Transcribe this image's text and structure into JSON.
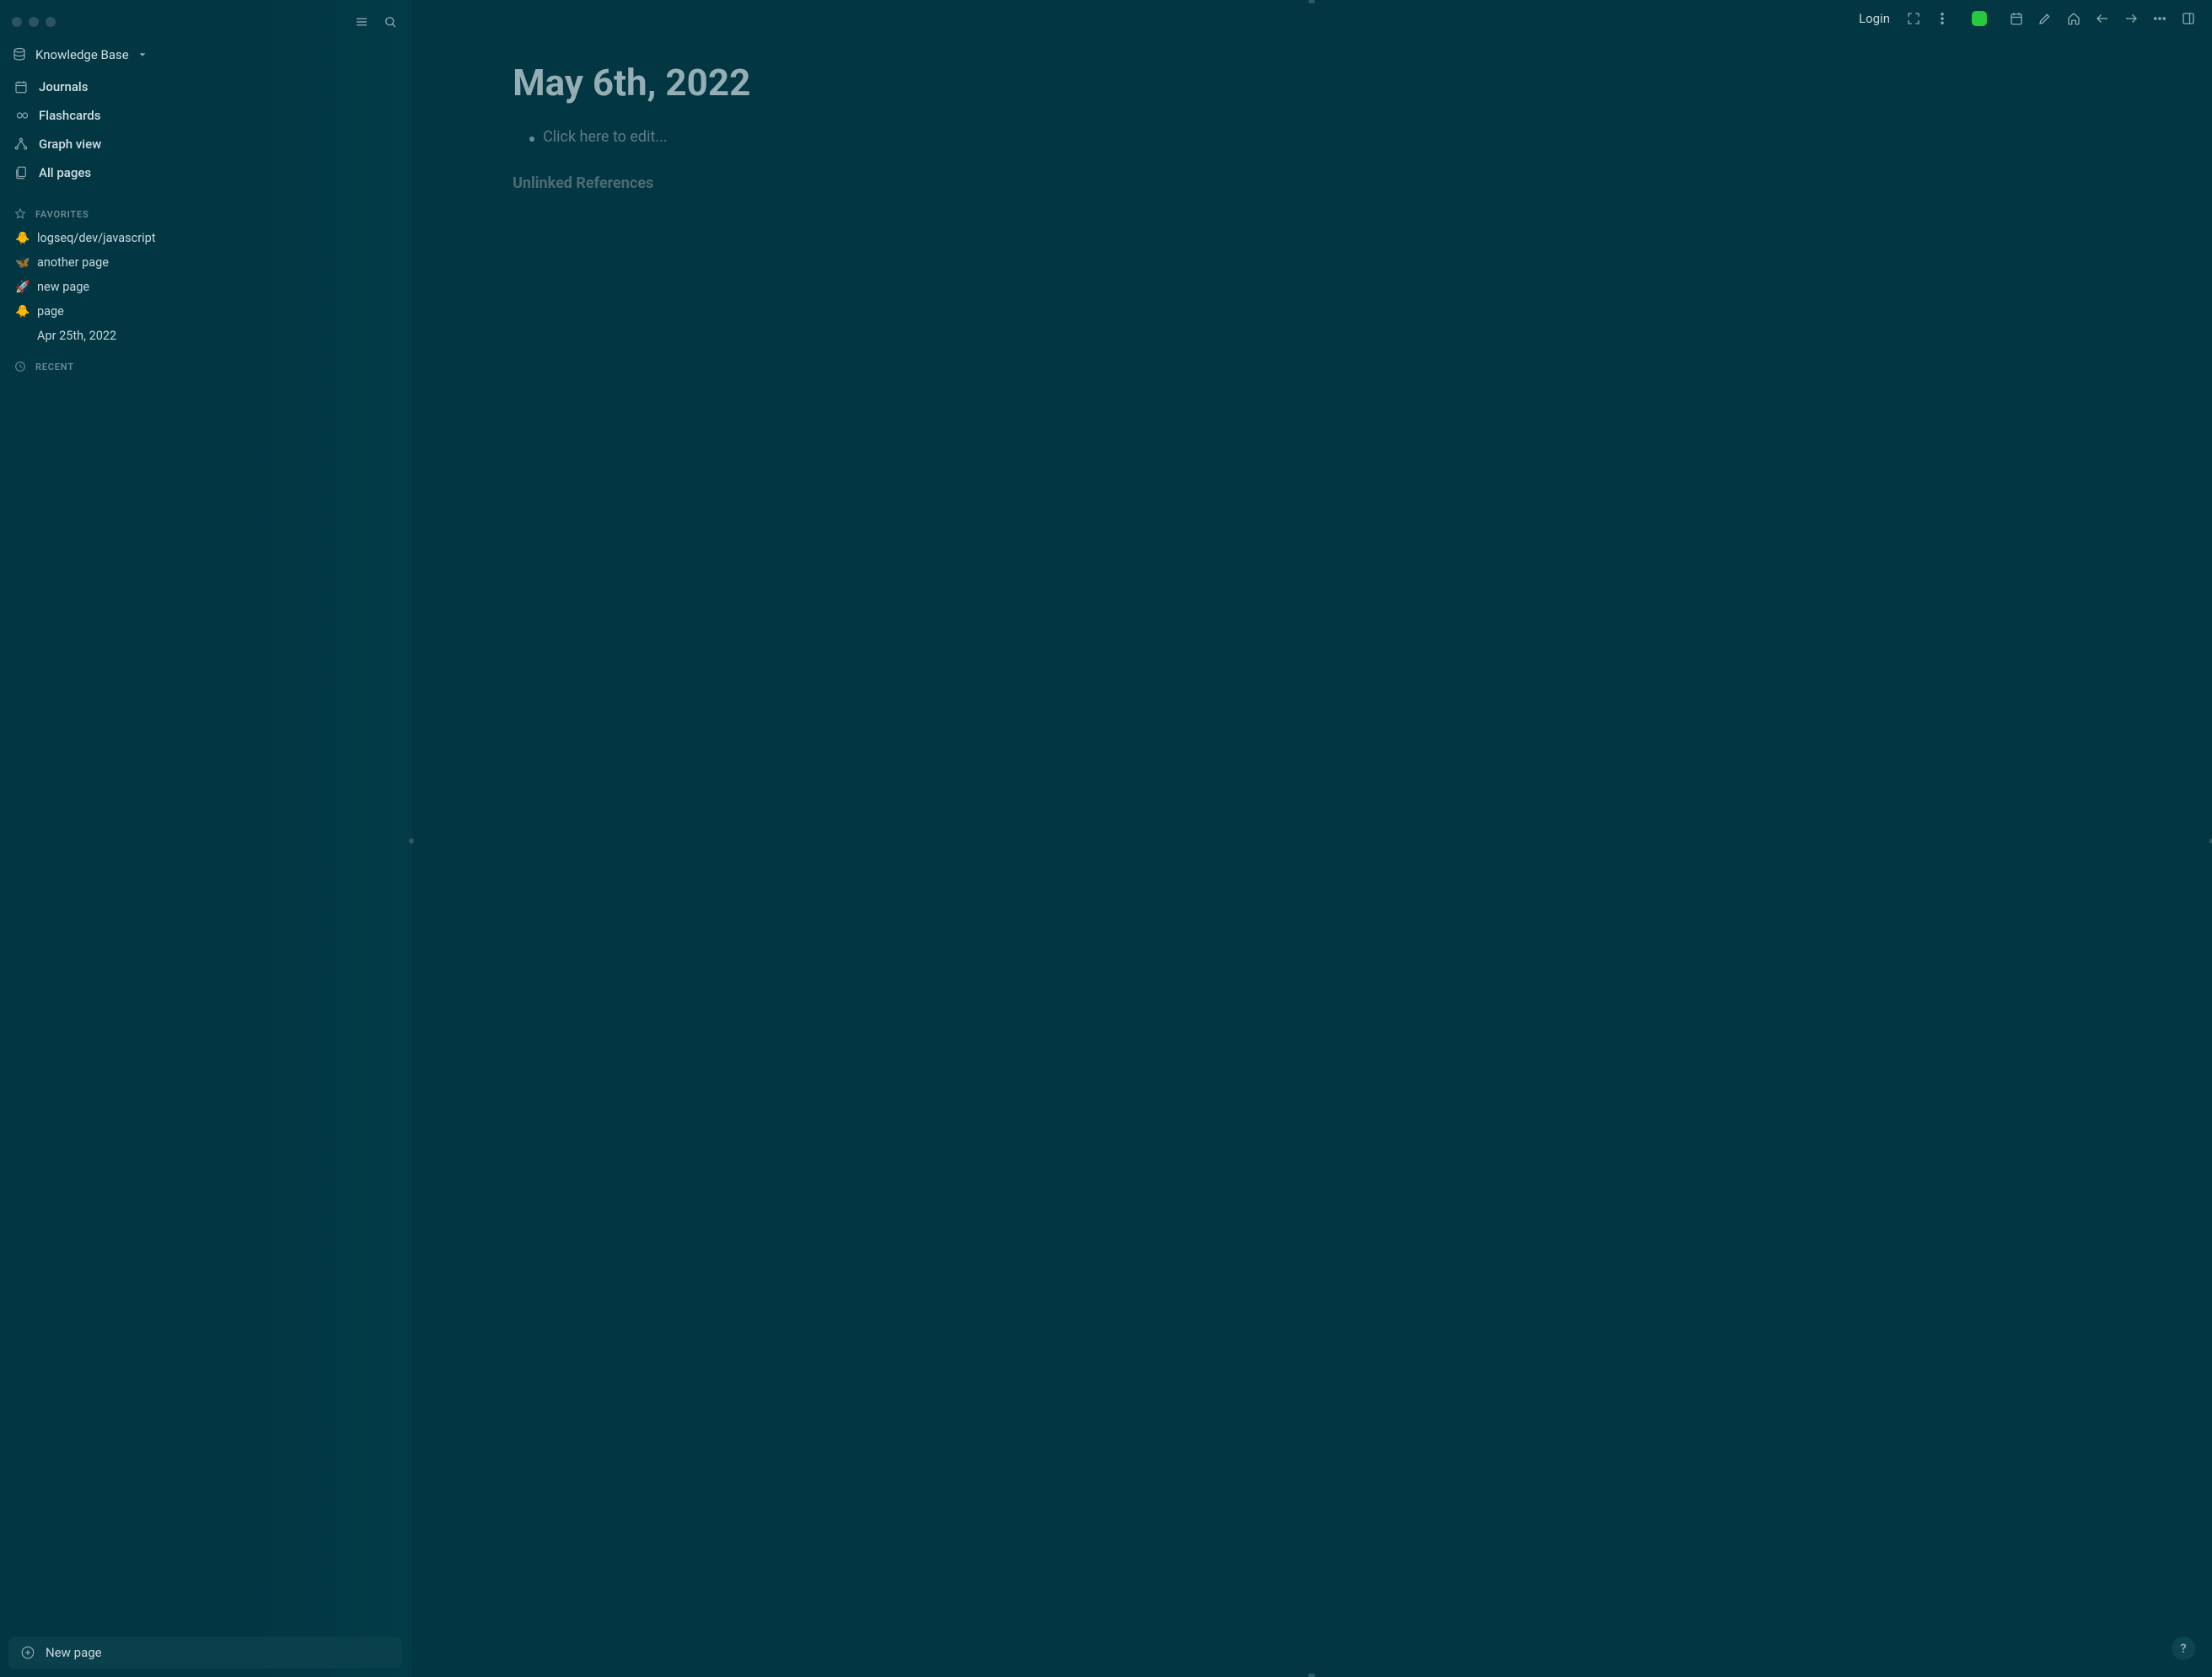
{
  "sidebar": {
    "repo_name": "Knowledge Base",
    "nav": {
      "journals": "Journals",
      "flashcards": "Flashcards",
      "graph_view": "Graph view",
      "all_pages": "All pages"
    },
    "favorites_header": "FAVORITES",
    "favorites": [
      {
        "emoji": "🐥",
        "label": "logseq/dev/javascript"
      },
      {
        "emoji": "🦋",
        "label": "another page"
      },
      {
        "emoji": "🚀",
        "label": "new page"
      },
      {
        "emoji": "🐥",
        "label": "page"
      },
      {
        "emoji": "",
        "label": "Apr 25th, 2022"
      }
    ],
    "recent_header": "RECENT",
    "new_page": "New page"
  },
  "toolbar": {
    "login": "Login"
  },
  "journal": {
    "title": "May 6th, 2022",
    "placeholder": "Click here to edit...",
    "unlinked_refs": "Unlinked References"
  },
  "help": "?"
}
